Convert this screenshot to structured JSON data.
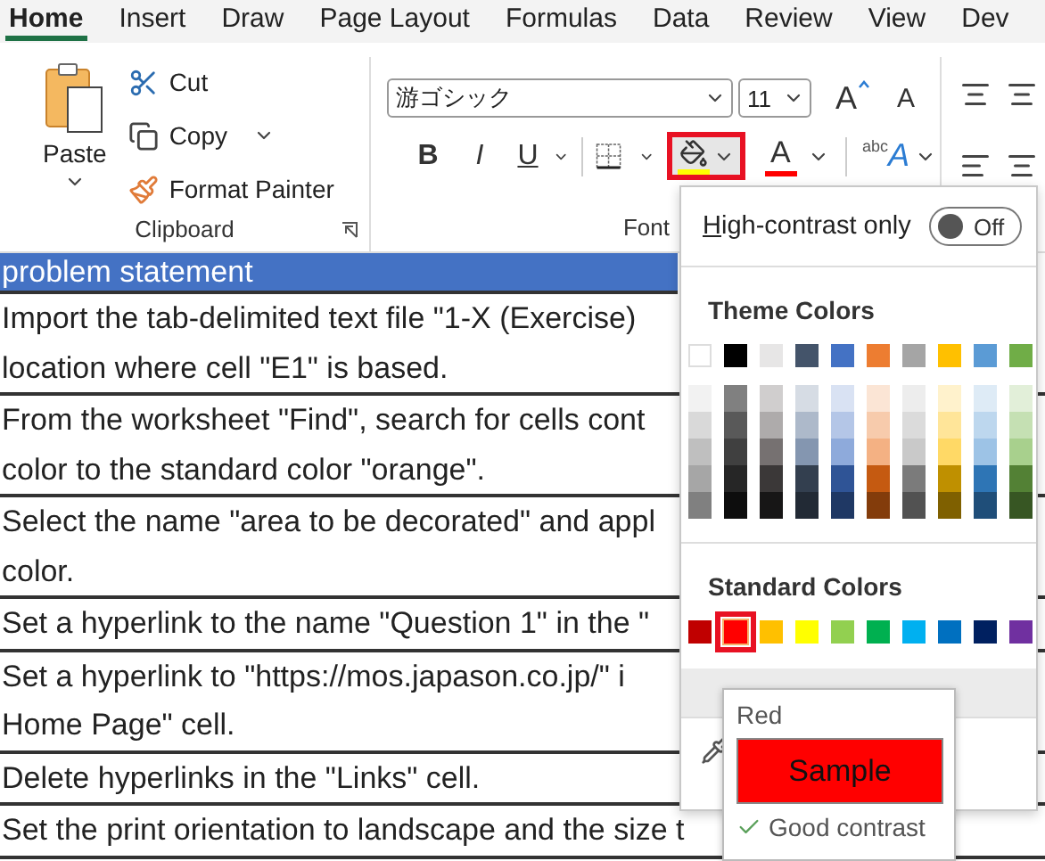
{
  "tabs": [
    {
      "label": "Home",
      "selected": true
    },
    {
      "label": "Insert",
      "selected": false
    },
    {
      "label": "Draw",
      "selected": false
    },
    {
      "label": "Page Layout",
      "selected": false
    },
    {
      "label": "Formulas",
      "selected": false
    },
    {
      "label": "Data",
      "selected": false
    },
    {
      "label": "Review",
      "selected": false
    },
    {
      "label": "View",
      "selected": false
    },
    {
      "label": "Dev",
      "selected": false
    }
  ],
  "clipboard": {
    "paste": "Paste",
    "cut": "Cut",
    "copy": "Copy",
    "format_painter": "Format Painter",
    "label": "Clipboard"
  },
  "font": {
    "name": "游ゴシック",
    "size": "11",
    "grow": "A",
    "shrink": "A",
    "bold": "B",
    "italic": "I",
    "underline": "U",
    "fill_color": {
      "color": "#ffff00",
      "highlighted": true
    },
    "font_color": {
      "label": "A",
      "color": "#ff0000"
    },
    "phonetic": {
      "small": "abc",
      "large": "A"
    },
    "label": "Font"
  },
  "color_menu": {
    "high_contrast": {
      "access_key": "H",
      "rest": "igh-contrast only",
      "on": false,
      "state_label": "Off"
    },
    "theme_title": "Theme Colors",
    "theme_colors": [
      {
        "color": "#ffffff",
        "shades": [
          {
            "color": "#f2f2f2"
          },
          {
            "color": "#d9d9d9"
          },
          {
            "color": "#bfbfbf"
          },
          {
            "color": "#a6a6a6"
          },
          {
            "color": "#808080"
          }
        ]
      },
      {
        "color": "#000000",
        "shades": [
          {
            "color": "#808080"
          },
          {
            "color": "#595959"
          },
          {
            "color": "#404040"
          },
          {
            "color": "#262626"
          },
          {
            "color": "#0d0d0d"
          }
        ]
      },
      {
        "color": "#e7e6e6",
        "shades": [
          {
            "color": "#d0cece"
          },
          {
            "color": "#aeabab"
          },
          {
            "color": "#767171"
          },
          {
            "color": "#3b3838"
          },
          {
            "color": "#171616"
          }
        ]
      },
      {
        "color": "#44546a",
        "shades": [
          {
            "color": "#d6dce4"
          },
          {
            "color": "#adb9ca"
          },
          {
            "color": "#8496b0"
          },
          {
            "color": "#333f4f"
          },
          {
            "color": "#222a35"
          }
        ]
      },
      {
        "color": "#4472c4",
        "shades": [
          {
            "color": "#d9e2f3"
          },
          {
            "color": "#b4c6e7"
          },
          {
            "color": "#8eaadb"
          },
          {
            "color": "#2f5496"
          },
          {
            "color": "#1f3864"
          }
        ]
      },
      {
        "color": "#ed7d31",
        "shades": [
          {
            "color": "#fbe5d5"
          },
          {
            "color": "#f7cbac"
          },
          {
            "color": "#f4b183"
          },
          {
            "color": "#c55a11"
          },
          {
            "color": "#833c0b"
          }
        ]
      },
      {
        "color": "#a5a5a5",
        "shades": [
          {
            "color": "#ededed"
          },
          {
            "color": "#dbdbdb"
          },
          {
            "color": "#c9c9c9"
          },
          {
            "color": "#7b7b7b"
          },
          {
            "color": "#525252"
          }
        ]
      },
      {
        "color": "#ffc000",
        "shades": [
          {
            "color": "#fff2cc"
          },
          {
            "color": "#ffe599"
          },
          {
            "color": "#ffd966"
          },
          {
            "color": "#bf9000"
          },
          {
            "color": "#7f6000"
          }
        ]
      },
      {
        "color": "#5b9bd5",
        "shades": [
          {
            "color": "#deebf6"
          },
          {
            "color": "#bdd7ee"
          },
          {
            "color": "#9dc3e6"
          },
          {
            "color": "#2e75b5"
          },
          {
            "color": "#1f4e79"
          }
        ]
      },
      {
        "color": "#70ad47",
        "shades": [
          {
            "color": "#e2efd9"
          },
          {
            "color": "#c5e0b3"
          },
          {
            "color": "#a8d08d"
          },
          {
            "color": "#538135"
          },
          {
            "color": "#375623"
          }
        ]
      }
    ],
    "standard_title": "Standard Colors",
    "standard_colors": [
      {
        "color": "#c00000",
        "selected": false
      },
      {
        "color": "#ff0000",
        "selected": true
      },
      {
        "color": "#ffc000",
        "selected": false
      },
      {
        "color": "#ffff00",
        "selected": false
      },
      {
        "color": "#92d050",
        "selected": false
      },
      {
        "color": "#00b050",
        "selected": false
      },
      {
        "color": "#00b0f0",
        "selected": false
      },
      {
        "color": "#0070c0",
        "selected": false
      },
      {
        "color": "#002060",
        "selected": false
      },
      {
        "color": "#7030a0",
        "selected": false
      }
    ]
  },
  "tooltip": {
    "title": "Red",
    "sample": "Sample",
    "color": "#ff0000",
    "contrast": "Good contrast",
    "contrast_ok": true
  },
  "sheet": {
    "rows": [
      {
        "lines": [
          "problem statement"
        ],
        "selected": true
      },
      {
        "lines": [
          "Import the tab-delimited text file \"1-X (Exercise)",
          "location where cell \"E1\" is based."
        ],
        "selected": false
      },
      {
        "lines": [
          "From the worksheet \"Find\", search for cells cont",
          "color to the standard color \"orange\"."
        ],
        "selected": false
      },
      {
        "lines": [
          "Select the name \"area to be decorated\" and appl",
          "color."
        ],
        "selected": false
      },
      {
        "lines": [
          "Set a hyperlink to the name \"Question 1\" in the \""
        ],
        "selected": false
      },
      {
        "lines": [
          "Set a hyperlink to \"https://mos.japason.co.jp/\" i",
          "Home Page\" cell."
        ],
        "selected": false
      },
      {
        "lines": [
          "Delete hyperlinks in the \"Links\" cell."
        ],
        "selected": false
      },
      {
        "lines": [
          "Set the print orientation to landscape and the size t"
        ],
        "selected": false
      }
    ]
  }
}
